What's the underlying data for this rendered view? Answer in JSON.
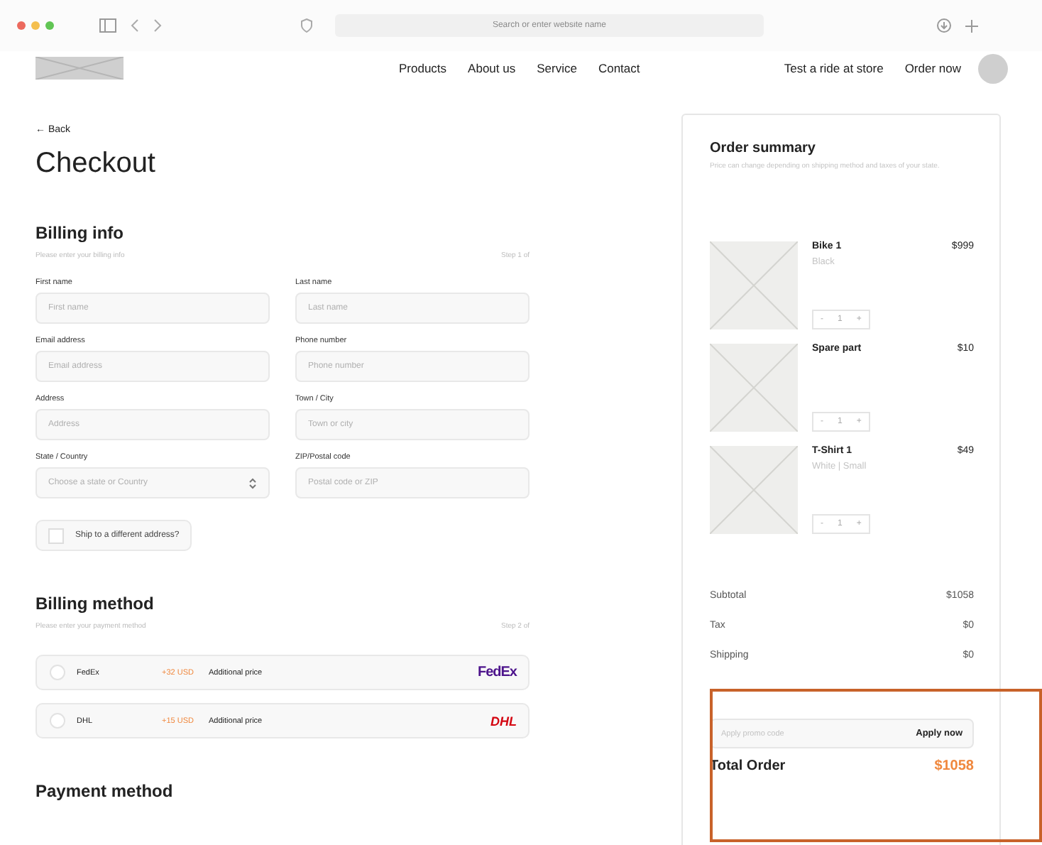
{
  "browser": {
    "address_placeholder": "Search or enter website name"
  },
  "nav": {
    "links": [
      "Products",
      "About us",
      "Service",
      "Contact"
    ],
    "actions": [
      "Test a ride at store",
      "Order now"
    ]
  },
  "back": "← Back",
  "title": "Checkout",
  "billing_info": {
    "heading": "Billing info",
    "subtitle": "Please enter your billing info",
    "step": "Step 1 of",
    "fields": [
      {
        "label": "First name",
        "placeholder": "First name",
        "kind": "text"
      },
      {
        "label": "Last name",
        "placeholder": "Last name",
        "kind": "text"
      },
      {
        "label": "Email address",
        "placeholder": "Email address",
        "kind": "text"
      },
      {
        "label": "Phone number",
        "placeholder": "Phone number",
        "kind": "text"
      },
      {
        "label": "Address",
        "placeholder": "Address",
        "kind": "text"
      },
      {
        "label": "Town / City",
        "placeholder": "Town or city",
        "kind": "text"
      },
      {
        "label": "State / Country",
        "placeholder": "Choose a state or Country",
        "kind": "select"
      },
      {
        "label": "ZIP/Postal code",
        "placeholder": "Postal code or ZIP",
        "kind": "text"
      }
    ],
    "ship_different": {
      "label": "Ship to a different address?",
      "checked": false
    }
  },
  "billing_method": {
    "heading": "Billing method",
    "subtitle": "Please enter your payment method",
    "step": "Step 2 of",
    "options": [
      {
        "name": "FedEx",
        "price": "+32 USD",
        "note": "Additional price",
        "logo": "FedEx",
        "kind": "fedex",
        "selected": false
      },
      {
        "name": "DHL",
        "price": "+15 USD",
        "note": "Additional price",
        "logo": "DHL",
        "kind": "dhl",
        "selected": false
      }
    ]
  },
  "payment_method": {
    "heading": "Payment method"
  },
  "order_summary": {
    "heading": "Order summary",
    "subtitle": "Price can change depending on shipping method and taxes of your state.",
    "items": [
      {
        "name": "Bike 1",
        "variant": "Black",
        "price": "$999",
        "quantity": "1",
        "minus": "-",
        "plus": "+"
      },
      {
        "name": "Spare part",
        "price": "$10",
        "quantity": "1",
        "minus": "-",
        "plus": "+"
      },
      {
        "name": "T-Shirt 1",
        "variant": "White | Small",
        "price": "$49",
        "quantity": "1",
        "minus": "-",
        "plus": "+"
      }
    ],
    "totals": [
      {
        "label": "Subtotal",
        "value": "$1058"
      },
      {
        "label": "Tax",
        "value": "$0"
      },
      {
        "label": "Shipping",
        "value": "$0"
      }
    ],
    "promo_placeholder": "Apply promo code",
    "promo_button": "Apply now",
    "total_label": "Total Order",
    "total_value": "$1058"
  }
}
